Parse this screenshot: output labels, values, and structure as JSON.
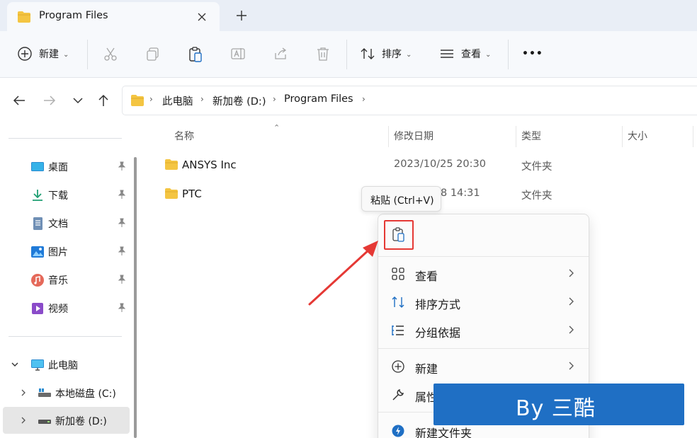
{
  "tab": {
    "title": "Program Files"
  },
  "toolbar": {
    "new_label": "新建",
    "sort_label": "排序",
    "view_label": "查看",
    "more_label": "•••"
  },
  "breadcrumb": {
    "items": [
      "此电脑",
      "新加卷 (D:)",
      "Program Files"
    ]
  },
  "sidebar": {
    "quick": [
      {
        "label": "桌面",
        "icon": "desktop-icon"
      },
      {
        "label": "下载",
        "icon": "download-icon"
      },
      {
        "label": "文档",
        "icon": "document-icon"
      },
      {
        "label": "图片",
        "icon": "pictures-icon"
      },
      {
        "label": "音乐",
        "icon": "music-icon"
      },
      {
        "label": "视频",
        "icon": "video-icon"
      }
    ],
    "this_pc": "此电脑",
    "drives": [
      "本地磁盘 (C:)",
      "新加卷 (D:)"
    ]
  },
  "columns": {
    "name": "名称",
    "date": "修改日期",
    "type": "类型",
    "size": "大小"
  },
  "files": [
    {
      "name": "ANSYS Inc",
      "date": "2023/10/25 20:30",
      "type": "文件夹"
    },
    {
      "name": "PTC",
      "date": "8 14:31",
      "type": "文件夹"
    }
  ],
  "tooltip": "粘贴 (Ctrl+V)",
  "context_menu": {
    "items": [
      {
        "label": "查看"
      },
      {
        "label": "排序方式"
      },
      {
        "label": "分组依据"
      },
      {
        "label": "新建"
      },
      {
        "label": "属性"
      },
      {
        "label": "新建文件夹"
      }
    ]
  },
  "banner": "By 三酷",
  "colors": {
    "accent": "#1f6fc4",
    "highlight": "#e53935",
    "folder": "#f4c542"
  }
}
